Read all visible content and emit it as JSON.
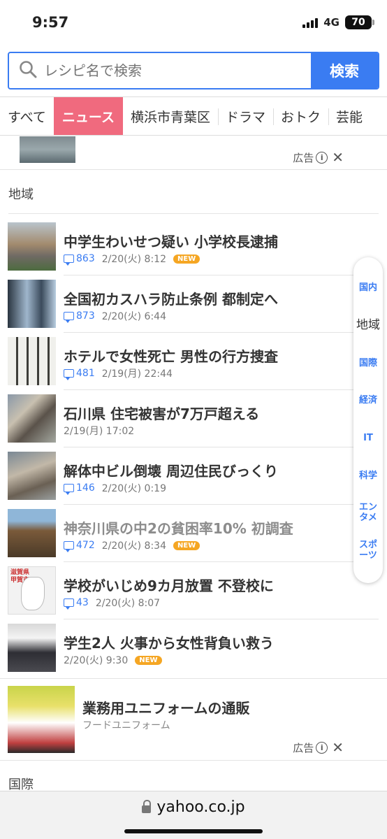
{
  "status_bar": {
    "time": "9:57",
    "network": "4G",
    "battery": "70"
  },
  "search": {
    "placeholder": "レシピ名で検索",
    "button_label": "検索"
  },
  "tabs": [
    {
      "label": "すべて",
      "active": false
    },
    {
      "label": "ニュース",
      "active": true
    },
    {
      "label": "横浜市青葉区",
      "active": false
    },
    {
      "label": "ドラマ",
      "active": false
    },
    {
      "label": "おトク",
      "active": false
    },
    {
      "label": "芸能",
      "active": false
    }
  ],
  "top_ad": {
    "ad_label": "広告",
    "info_glyph": "i",
    "close_glyph": "✕"
  },
  "section_regional": {
    "title": "地域"
  },
  "news": [
    {
      "title": "中学生わいせつ疑い 小学校長逮捕",
      "comments": "863",
      "date": "2/20(火) 8:12",
      "new": "NEW"
    },
    {
      "title": "全国初カスハラ防止条例 都制定へ",
      "comments": "873",
      "date": "2/20(火) 6:44"
    },
    {
      "title": "ホテルで女性死亡 男性の行方捜査",
      "comments": "481",
      "date": "2/19(月) 22:44"
    },
    {
      "title": "石川県 住宅被害が7万戸超える",
      "date": "2/19(月) 17:02"
    },
    {
      "title": "解体中ビル倒壊 周辺住民びっくり",
      "comments": "146",
      "date": "2/20(火) 0:19"
    },
    {
      "title": "神奈川県の中2の貧困率10% 初調査",
      "comments": "472",
      "date": "2/20(火) 8:34",
      "new": "NEW"
    },
    {
      "title": "学校がいじめ9カ月放置 不登校に",
      "comments": "43",
      "date": "2/20(火) 8:07"
    },
    {
      "title": "学生2人 火事から女性背負い救う",
      "date": "2/20(火) 9:30",
      "new": "NEW"
    }
  ],
  "thumb7_label": "滋賀県\n甲賀市",
  "bottom_ad": {
    "title": "業務用ユニフォームの通販",
    "sponsor": "フードユニフォーム",
    "ad_label": "広告",
    "info_glyph": "i",
    "close_glyph": "✕"
  },
  "section_international": {
    "title": "国際"
  },
  "side_nav": [
    "国内",
    "地域",
    "国際",
    "経済",
    "IT",
    "科学",
    "エン\nタメ",
    "スポ\nーツ"
  ],
  "browser": {
    "url": "yahoo.co.jp"
  }
}
